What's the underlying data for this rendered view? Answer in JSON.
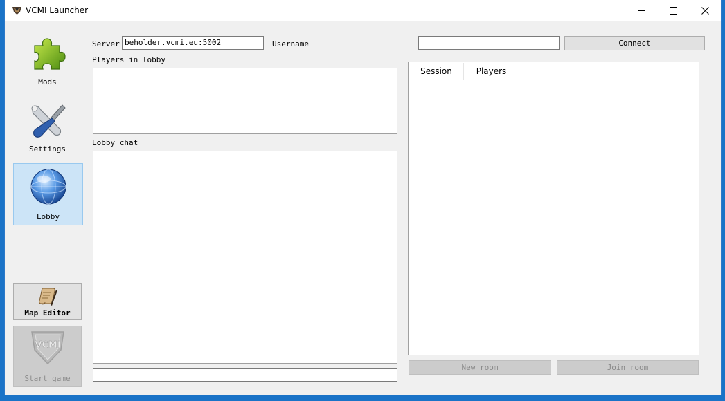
{
  "window": {
    "title": "VCMI Launcher"
  },
  "nav": {
    "mods": {
      "label": "Mods",
      "icon": "puzzle-icon"
    },
    "settings": {
      "label": "Settings",
      "icon": "wrench-screwdriver-icon"
    },
    "lobby": {
      "label": "Lobby",
      "icon": "globe-icon"
    }
  },
  "tools": {
    "map_editor": {
      "label": "Map Editor",
      "icon": "scroll-quill-icon"
    },
    "start_game": {
      "label": "Start game",
      "icon": "vcmi-shield-icon"
    }
  },
  "lobby": {
    "server_label": "Server",
    "server_value": "beholder.vcmi.eu:5002",
    "username_label": "Username",
    "username_value": "",
    "connect_label": "Connect",
    "players_label": "Players in lobby",
    "chat_label": "Lobby chat",
    "chat_input_value": "",
    "sessions_columns": [
      "Session",
      "Players"
    ],
    "new_room_label": "New room",
    "join_room_label": "Join room"
  }
}
